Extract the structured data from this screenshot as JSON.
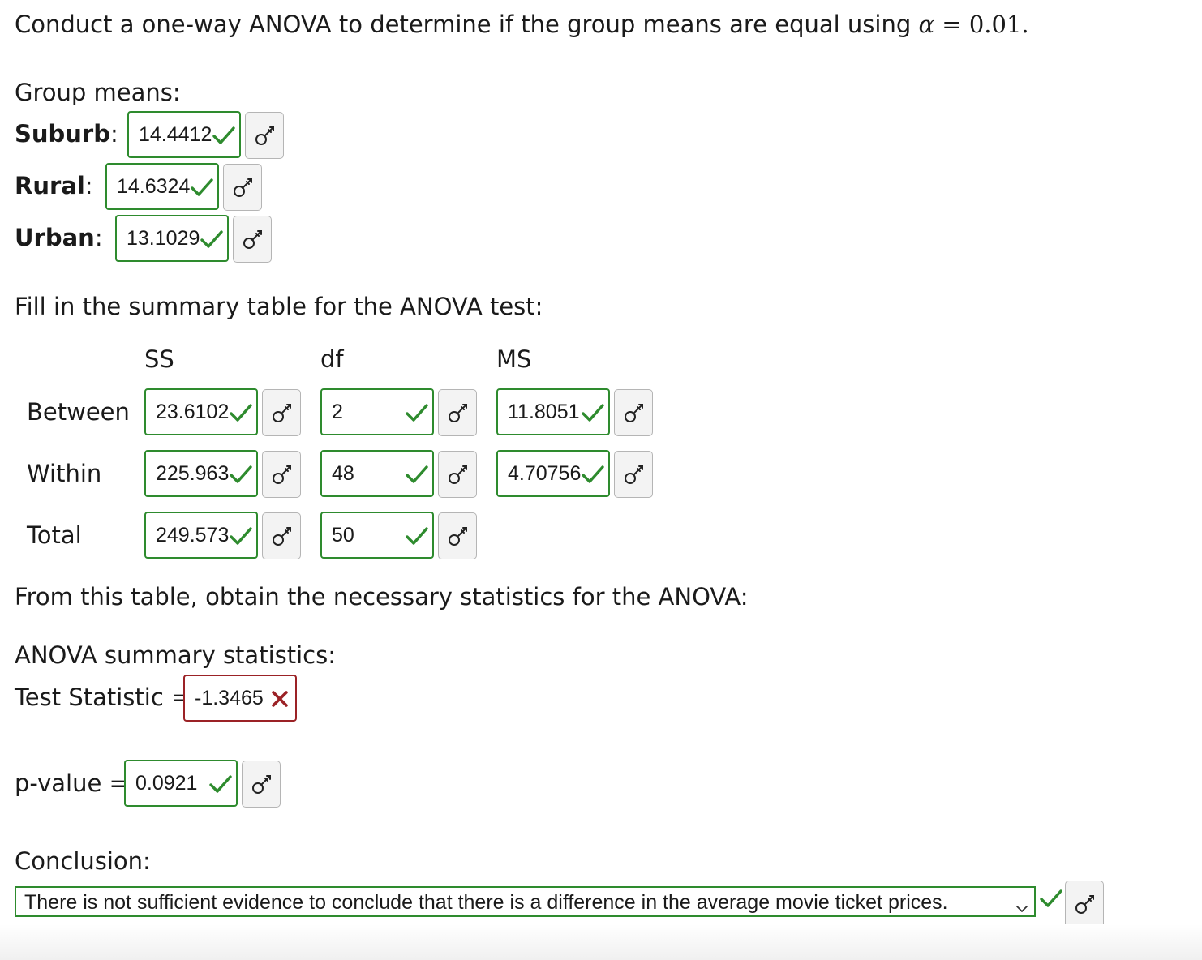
{
  "question": {
    "prompt": "Conduct a one-way ANOVA to determine if the group means are equal using",
    "alpha_symbol": "α",
    "alpha_eq": "=",
    "alpha_value": "0.01.",
    "group_means_label": "Group means:",
    "groups": [
      {
        "label": "Suburb",
        "colon": ":",
        "value": "14.4412",
        "status": "correct"
      },
      {
        "label": "Rural",
        "colon": ":",
        "value": "14.6324",
        "status": "correct"
      },
      {
        "label": "Urban",
        "colon": ":",
        "value": "13.1029",
        "status": "correct"
      }
    ]
  },
  "table": {
    "instruction": "Fill in the summary table for the ANOVA test:",
    "headers": {
      "ss": "SS",
      "df": "df",
      "ms": "MS"
    },
    "rows": [
      {
        "label": "Between",
        "ss": "23.6102",
        "df": "2",
        "ms": "11.8051"
      },
      {
        "label": "Within",
        "ss": "225.963",
        "df": "48",
        "ms": "4.70756"
      },
      {
        "label": "Total",
        "ss": "249.573",
        "df": "50"
      }
    ]
  },
  "stats": {
    "instruction": "From this table, obtain the necessary statistics for the ANOVA:",
    "summary_label": "ANOVA summary statistics:",
    "test_statistic_label": "Test Statistic =",
    "test_statistic_value": "-1.3465",
    "test_statistic_status": "incorrect",
    "pvalue_label": "p-value =",
    "pvalue_value": "0.0921",
    "pvalue_status": "correct"
  },
  "conclusion": {
    "label": "Conclusion:",
    "selected": "There is not sufficient evidence to conclude that there is a difference in the average movie ticket prices.",
    "status": "correct"
  },
  "icons": {
    "correct": "check-icon",
    "incorrect": "cross-icon",
    "key": "key-icon",
    "dropdown": "chevron-down-icon"
  },
  "colors": {
    "correct": "#2e8b2e",
    "incorrect": "#9b2226",
    "key_button_bg": "#f3f3f3"
  }
}
